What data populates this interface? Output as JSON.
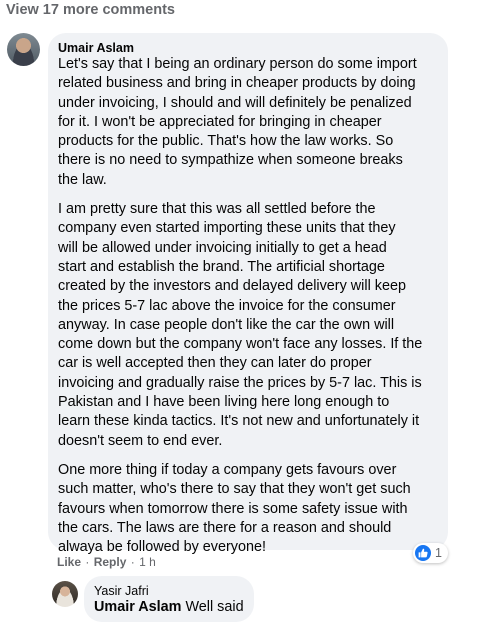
{
  "view_more_label": "View 17 more comments",
  "comment": {
    "author": "Umair Aslam",
    "paragraphs": [
      [
        "Let's say that I being an ordinary person do some import",
        "related business and bring in cheaper products by doing",
        "under invoicing, I should and will definitely be penalized",
        "for it. I won't be appreciated for bringing in cheaper",
        "products for the public. That's how the law works. So",
        "there is no need to sympathize when someone breaks",
        "the law."
      ],
      [
        "I am pretty sure that this was all settled before the",
        "company even started importing these units that they",
        "will be allowed under invoicing initially to get a head",
        "start and establish the brand. The artificial shortage",
        "created by the investors and delayed delivery will keep",
        "the prices 5-7 lac above the invoice for the consumer",
        "anyway. In case people don't like the car the own will",
        "come down but the company won't face any losses. If the",
        "car is well accepted then they can later do proper",
        "invoicing and gradually raise the prices by 5-7 lac. This is",
        "Pakistan and I have been living here long enough to",
        "learn these kinda tactics. It's not new and unfortunately it",
        "doesn't seem to end ever."
      ],
      [
        "One more thing if today a company gets favours over",
        "such matter, who's there to say that they won't get such",
        "favours when tomorrow there is some safety issue with",
        "the cars. The laws are there for a reason and should",
        "alwaya be followed by everyone!"
      ]
    ],
    "like_label": "Like",
    "reply_label": "Reply",
    "separator": "·",
    "time": "1 h",
    "reaction_count": "1"
  },
  "reply": {
    "author": "Yasir Jafri",
    "mention": "Umair Aslam",
    "text": " Well said"
  },
  "colors": {
    "bubble_bg": "#f0f2f5",
    "meta_text": "#65676b",
    "like_blue": "#1877f2"
  }
}
